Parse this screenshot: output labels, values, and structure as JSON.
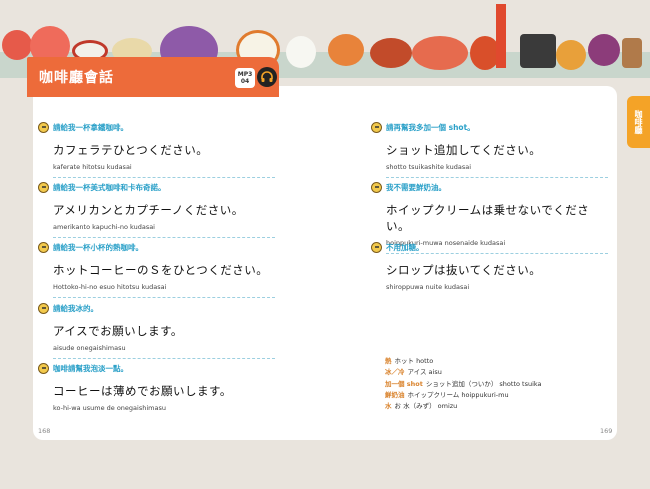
{
  "header": {
    "title": "咖啡廳會話",
    "mp3_label": "MP3",
    "mp3_track": "04"
  },
  "side_tab": {
    "label": "咖啡廳"
  },
  "colors": {
    "accent": "#ed6b3a",
    "side_tab": "#f4a327",
    "chinese_text": "#2aa0c8",
    "vocab_key": "#d9822b"
  },
  "left_column": [
    {
      "zh": "請給我一杯拿鐵咖啡。",
      "jp": "カフェラテひとつください。",
      "romaji": "kaferate hitotsu kudasai"
    },
    {
      "zh": "請給我一杯美式咖啡和卡布奇諾。",
      "jp": "アメリカンとカプチーノください。",
      "romaji": "amerikanto kapuchi-no kudasai"
    },
    {
      "zh": "請給我一杯小杯的熱咖啡。",
      "jp": "ホットコーヒーのＳをひとつください。",
      "romaji": "Hottoko-hi-no esuo hitotsu kudasai"
    },
    {
      "zh": "請給我冰的。",
      "jp": "アイスでお願いします。",
      "romaji": "aisude onegaishimasu"
    },
    {
      "zh": "咖啡請幫我泡淡一點。",
      "jp": "コーヒーは薄めでお願いします。",
      "romaji": "ko-hi-wa usume de onegaishimasu"
    }
  ],
  "right_column": [
    {
      "zh": "請再幫我多加一個 shot。",
      "jp": "ショット追加してください。",
      "romaji": "shotto tsuikashite kudasai"
    },
    {
      "zh": "我不需要鮮奶油。",
      "jp": "ホイップクリームは乗せないでください。",
      "romaji": "hoippukuri-muwa nosenaide kudasai"
    },
    {
      "zh": "不用加糖。",
      "jp": "シロップは抜いてください。",
      "romaji": "shiroppuwa nuite kudasai"
    }
  ],
  "vocabulary": [
    {
      "key": "熱",
      "value": "ホット hotto"
    },
    {
      "key": "冰／冷",
      "value": "アイス aisu"
    },
    {
      "key": "加一個 shot",
      "value": "ショット追加（ついか） shotto tsuika"
    },
    {
      "key": "鮮奶油",
      "value": "ホイップクリーム hoippukuri-mu"
    },
    {
      "key": "水",
      "value": "お 水（みず） omizu"
    }
  ],
  "pages": {
    "left": "168",
    "right": "169"
  }
}
